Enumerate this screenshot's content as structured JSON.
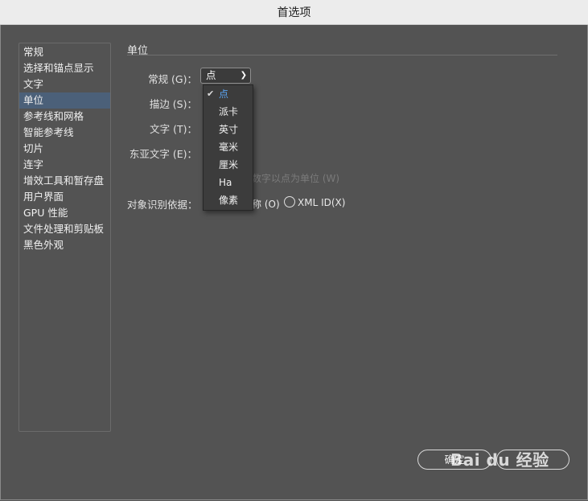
{
  "window": {
    "title": "首选项"
  },
  "sidebar": {
    "items": [
      {
        "label": "常规"
      },
      {
        "label": "选择和锚点显示"
      },
      {
        "label": "文字"
      },
      {
        "label": "单位"
      },
      {
        "label": "参考线和网格"
      },
      {
        "label": "智能参考线"
      },
      {
        "label": "切片"
      },
      {
        "label": "连字"
      },
      {
        "label": "增效工具和暂存盘"
      },
      {
        "label": "用户界面"
      },
      {
        "label": "GPU 性能"
      },
      {
        "label": "文件处理和剪贴板"
      },
      {
        "label": "黑色外观"
      }
    ],
    "selected": "单位"
  },
  "units": {
    "section_title": "单位",
    "general_label": "常规 (G)：",
    "stroke_label": "描边 (S)：",
    "type_label": "文字 (T)：",
    "asian_type_label": "东亚文字 (E)：",
    "general_value": "点",
    "numbers_checkbox_text": "数字以点为单位 (W)"
  },
  "dropdown": {
    "options": [
      "点",
      "派卡",
      "英寸",
      "毫米",
      "厘米",
      "Ha",
      "像素"
    ],
    "checked": "点"
  },
  "object_id": {
    "label": "对象识别依据：",
    "name_option_text": "称 (O)",
    "xml_option": "XML ID(X)"
  },
  "buttons": {
    "ok_label": "确定"
  },
  "watermark": {
    "text": "Bai du 经验"
  },
  "colors": {
    "background": "#535353",
    "selection": "#4b6079",
    "checked_option": "#5aa4f3"
  }
}
